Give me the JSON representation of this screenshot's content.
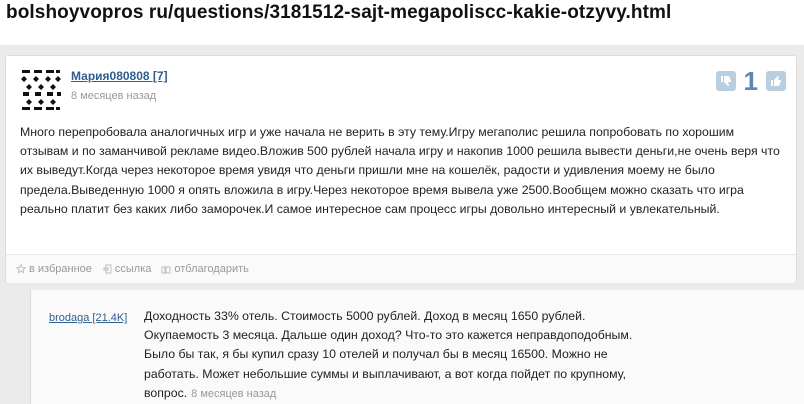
{
  "url": "bolshoyvopros ru/questions/3181512-sajt-megapoliscc-kakie-otzyvy.html",
  "answer": {
    "author": "Мария080808 [7]",
    "time": "8 месяцев назад",
    "vote_count": "1",
    "text": "Много перепробовала аналогичных игр и уже начала не верить в эту тему.Игру мегаполис решила попробовать по хорошим отзывам и по заманчивой рекламе видео.Вложив 500 рублей начала игру и накопив 1000 решила вывести деньги,не очень веря что их выведут.Когда через некоторое время увидя что деньги пришли мне на кошелёк, радости и удивления моему не было предела.Выведенную 1000 я опять вложила в игру.Через некоторое время вывела уже 2500.Вообщем можно сказать что игра реально платит без каких либо заморочек.И самое интересное сам процесс игры довольно интересный и увлекательный.",
    "actions": {
      "favorite": "в избранное",
      "link": "ссылка",
      "thank": "отблагодарить"
    }
  },
  "comment": {
    "author": "brodaga [21.4K]",
    "text": "Доходность 33% отель. Стоимость 5000 рублей. Доход в месяц 1650 рублей. Окупаемость 3 месяца. Дальше один доход? Что-то это кажется неправдоподобным. Было бы так, я бы купил сразу 10 отелей и получал бы в месяц 16500. Можно не работать. Может небольшие суммы и выплачивают, а вот когда пойдет по крупному, вопрос.",
    "time": "8 месяцев назад"
  }
}
